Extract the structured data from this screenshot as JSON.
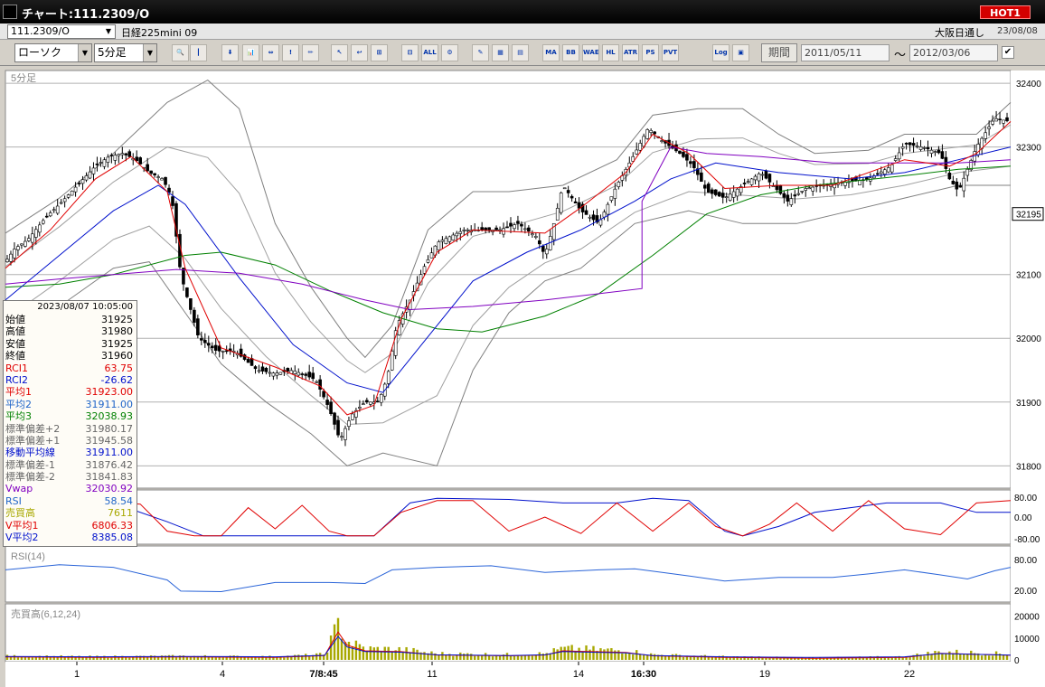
{
  "window": {
    "title": "チャート:111.2309/O",
    "hot_label": "HOT1"
  },
  "symbol_bar": {
    "symbol": "111.2309/O",
    "name": "日経225mini 09",
    "market": "大阪日通し",
    "date": "23/08/08"
  },
  "toolbar": {
    "chart_type": "ローソク",
    "interval": "5分足",
    "buttons": [
      "🔍",
      "┃",
      "⬇",
      "📊",
      "⇔",
      "!",
      "✏",
      "↖",
      "↩",
      "⊞",
      "⊟",
      "ALL",
      "⚙",
      "✎",
      "▦",
      "▤",
      "MA",
      "BB",
      "WAE",
      "HL",
      "ATR",
      "PS",
      "PVT",
      "Log",
      "▣"
    ],
    "period_label": "期間",
    "date_from": "2011/05/11",
    "date_to": "2012/03/06",
    "date_sep": "〜",
    "checked": "✔"
  },
  "colors": {
    "chart_bg": "#ffffff",
    "ma1": "#e00000",
    "ma2": "#0010cc",
    "ma3": "#008000",
    "vwap": "#8000c0",
    "bb": "#808080",
    "rsi_line": "#2a64d8",
    "volume": "#a8a800",
    "rci1": "#e00000",
    "rci2": "#0010cc"
  },
  "main_chart": {
    "label": "5分足",
    "y_axis": [
      "32400",
      "32300",
      "32195",
      "32100",
      "32000",
      "31900",
      "31800"
    ],
    "current_price": "32195",
    "ylim": [
      31765,
      32420
    ]
  },
  "rci_panel": {
    "y_axis": [
      "80.00",
      "0.00",
      "-80.00"
    ]
  },
  "rsi_panel": {
    "label": "RSI(14)",
    "y_axis": [
      "80.00",
      "20.00"
    ]
  },
  "volume_panel": {
    "label": "売買高(6,12,24)",
    "y_axis": [
      "20000",
      "10000",
      "0"
    ]
  },
  "x_axis": [
    "1",
    "4",
    "7/8:45",
    "11",
    "14",
    "16:30",
    "19",
    "22"
  ],
  "info_panel": {
    "timestamp": "2023/08/07  10:05:00",
    "rows": [
      {
        "label": "始値",
        "value": "31925",
        "color": "#000000"
      },
      {
        "label": "高値",
        "value": "31980",
        "color": "#000000"
      },
      {
        "label": "安値",
        "value": "31925",
        "color": "#000000"
      },
      {
        "label": "終値",
        "value": "31960",
        "color": "#000000"
      },
      {
        "label": "RCI1",
        "value": "63.75",
        "color": "#e00000"
      },
      {
        "label": "RCI2",
        "value": "-26.62",
        "color": "#0010cc"
      },
      {
        "label": "平均1",
        "value": "31923.00",
        "color": "#e00000"
      },
      {
        "label": "平均2",
        "value": "31911.00",
        "color": "#1e64c8"
      },
      {
        "label": "平均3",
        "value": "32038.93",
        "color": "#008000"
      },
      {
        "label": "標準偏差+2",
        "value": "31980.17",
        "color": "#666666"
      },
      {
        "label": "標準偏差+1",
        "value": "31945.58",
        "color": "#666666"
      },
      {
        "label": "移動平均線",
        "value": "31911.00",
        "color": "#0010cc"
      },
      {
        "label": "標準偏差-1",
        "value": "31876.42",
        "color": "#666666"
      },
      {
        "label": "標準偏差-2",
        "value": "31841.83",
        "color": "#666666"
      },
      {
        "label": "Vwap",
        "value": "32030.92",
        "color": "#8000c0"
      },
      {
        "label": "RSI",
        "value": "58.54",
        "color": "#1e64c8"
      },
      {
        "label": "売買高",
        "value": "7611",
        "color": "#a8a800"
      },
      {
        "label": "V平均1",
        "value": "6806.33",
        "color": "#e00000"
      },
      {
        "label": "V平均2",
        "value": "8385.08",
        "color": "#0010cc"
      }
    ]
  },
  "chart_data": {
    "type": "candlestick",
    "interval": "5分足",
    "ylim": [
      31765,
      32420
    ],
    "price_path": [
      [
        0,
        32120
      ],
      [
        10,
        32140
      ],
      [
        25,
        32155
      ],
      [
        45,
        32190
      ],
      [
        60,
        32210
      ],
      [
        80,
        32240
      ],
      [
        100,
        32270
      ],
      [
        115,
        32285
      ],
      [
        130,
        32290
      ],
      [
        145,
        32280
      ],
      [
        160,
        32260
      ],
      [
        175,
        32250
      ],
      [
        185,
        32220
      ],
      [
        195,
        32100
      ],
      [
        205,
        32050
      ],
      [
        215,
        32000
      ],
      [
        235,
        31980
      ],
      [
        255,
        31980
      ],
      [
        280,
        31950
      ],
      [
        300,
        31945
      ],
      [
        320,
        31950
      ],
      [
        345,
        31935
      ],
      [
        360,
        31890
      ],
      [
        372,
        31840
      ],
      [
        385,
        31880
      ],
      [
        400,
        31900
      ],
      [
        415,
        31900
      ],
      [
        425,
        31940
      ],
      [
        435,
        32020
      ],
      [
        450,
        32060
      ],
      [
        465,
        32110
      ],
      [
        480,
        32150
      ],
      [
        495,
        32160
      ],
      [
        510,
        32170
      ],
      [
        530,
        32170
      ],
      [
        550,
        32170
      ],
      [
        570,
        32180
      ],
      [
        590,
        32160
      ],
      [
        600,
        32130
      ],
      [
        610,
        32180
      ],
      [
        620,
        32240
      ],
      [
        640,
        32200
      ],
      [
        660,
        32180
      ],
      [
        680,
        32240
      ],
      [
        700,
        32290
      ],
      [
        715,
        32330
      ],
      [
        730,
        32310
      ],
      [
        750,
        32290
      ],
      [
        765,
        32270
      ],
      [
        780,
        32230
      ],
      [
        800,
        32220
      ],
      [
        820,
        32240
      ],
      [
        840,
        32260
      ],
      [
        860,
        32230
      ],
      [
        870,
        32215
      ],
      [
        890,
        32235
      ],
      [
        910,
        32240
      ],
      [
        935,
        32245
      ],
      [
        960,
        32250
      ],
      [
        985,
        32270
      ],
      [
        1000,
        32305
      ],
      [
        1020,
        32300
      ],
      [
        1040,
        32290
      ],
      [
        1050,
        32250
      ],
      [
        1060,
        32230
      ],
      [
        1080,
        32300
      ],
      [
        1100,
        32345
      ],
      [
        1118,
        32340
      ]
    ],
    "ma_fast_path": [
      [
        0,
        32110
      ],
      [
        50,
        32170
      ],
      [
        100,
        32250
      ],
      [
        140,
        32285
      ],
      [
        180,
        32230
      ],
      [
        200,
        32110
      ],
      [
        240,
        31985
      ],
      [
        300,
        31955
      ],
      [
        350,
        31925
      ],
      [
        380,
        31880
      ],
      [
        410,
        31895
      ],
      [
        440,
        32030
      ],
      [
        480,
        32135
      ],
      [
        520,
        32170
      ],
      [
        600,
        32165
      ],
      [
        640,
        32205
      ],
      [
        690,
        32260
      ],
      [
        720,
        32320
      ],
      [
        760,
        32290
      ],
      [
        800,
        32235
      ],
      [
        860,
        32240
      ],
      [
        920,
        32240
      ],
      [
        1000,
        32280
      ],
      [
        1050,
        32270
      ],
      [
        1080,
        32290
      ],
      [
        1118,
        32340
      ]
    ],
    "ma_mid_path": [
      [
        0,
        32060
      ],
      [
        60,
        32130
      ],
      [
        120,
        32200
      ],
      [
        170,
        32240
      ],
      [
        200,
        32210
      ],
      [
        260,
        32095
      ],
      [
        320,
        31990
      ],
      [
        380,
        31930
      ],
      [
        420,
        31915
      ],
      [
        460,
        31985
      ],
      [
        520,
        32090
      ],
      [
        580,
        32135
      ],
      [
        640,
        32170
      ],
      [
        700,
        32215
      ],
      [
        740,
        32250
      ],
      [
        790,
        32275
      ],
      [
        860,
        32260
      ],
      [
        940,
        32250
      ],
      [
        1000,
        32260
      ],
      [
        1060,
        32280
      ],
      [
        1118,
        32300
      ]
    ],
    "ma_slow_path": [
      [
        0,
        32080
      ],
      [
        60,
        32085
      ],
      [
        120,
        32100
      ],
      [
        200,
        32130
      ],
      [
        240,
        32135
      ],
      [
        300,
        32115
      ],
      [
        360,
        32075
      ],
      [
        420,
        32040
      ],
      [
        480,
        32015
      ],
      [
        530,
        32010
      ],
      [
        600,
        32035
      ],
      [
        660,
        32070
      ],
      [
        720,
        32130
      ],
      [
        780,
        32195
      ],
      [
        840,
        32225
      ],
      [
        900,
        32240
      ],
      [
        1000,
        32255
      ],
      [
        1060,
        32265
      ],
      [
        1118,
        32270
      ]
    ],
    "vwap_path": [
      [
        0,
        32085
      ],
      [
        60,
        32093
      ],
      [
        120,
        32100
      ],
      [
        190,
        32108
      ],
      [
        260,
        32102
      ],
      [
        330,
        32085
      ],
      [
        400,
        32060
      ],
      [
        450,
        32045
      ],
      [
        520,
        32050
      ],
      [
        600,
        32060
      ],
      [
        660,
        32070
      ],
      [
        708,
        32078
      ],
      [
        708,
        32215
      ],
      [
        740,
        32300
      ],
      [
        780,
        32290
      ],
      [
        840,
        32285
      ],
      [
        920,
        32275
      ],
      [
        1000,
        32275
      ],
      [
        1060,
        32275
      ],
      [
        1118,
        32280
      ]
    ],
    "bb_upper_path": [
      [
        0,
        32165
      ],
      [
        60,
        32220
      ],
      [
        120,
        32290
      ],
      [
        180,
        32370
      ],
      [
        225,
        32405
      ],
      [
        260,
        32360
      ],
      [
        300,
        32180
      ],
      [
        340,
        32080
      ],
      [
        380,
        32000
      ],
      [
        400,
        31970
      ],
      [
        430,
        32020
      ],
      [
        470,
        32170
      ],
      [
        520,
        32230
      ],
      [
        560,
        32230
      ],
      [
        620,
        32240
      ],
      [
        680,
        32280
      ],
      [
        720,
        32350
      ],
      [
        770,
        32360
      ],
      [
        820,
        32360
      ],
      [
        860,
        32320
      ],
      [
        900,
        32290
      ],
      [
        960,
        32295
      ],
      [
        1000,
        32320
      ],
      [
        1050,
        32320
      ],
      [
        1080,
        32320
      ],
      [
        1118,
        32370
      ]
    ],
    "bb_lower_path": [
      [
        0,
        32000
      ],
      [
        60,
        32050
      ],
      [
        120,
        32110
      ],
      [
        160,
        32120
      ],
      [
        200,
        32040
      ],
      [
        240,
        31960
      ],
      [
        290,
        31900
      ],
      [
        340,
        31850
      ],
      [
        380,
        31800
      ],
      [
        420,
        31820
      ],
      [
        450,
        31810
      ],
      [
        480,
        31800
      ],
      [
        520,
        31950
      ],
      [
        560,
        32040
      ],
      [
        600,
        32090
      ],
      [
        640,
        32110
      ],
      [
        700,
        32180
      ],
      [
        760,
        32200
      ],
      [
        820,
        32180
      ],
      [
        880,
        32180
      ],
      [
        940,
        32200
      ],
      [
        1000,
        32220
      ],
      [
        1060,
        32240
      ],
      [
        1118,
        32240
      ]
    ],
    "rci1_path": [
      [
        0,
        70
      ],
      [
        30,
        70
      ],
      [
        60,
        -60
      ],
      [
        90,
        -20
      ],
      [
        120,
        65
      ],
      [
        150,
        55
      ],
      [
        180,
        -60
      ],
      [
        210,
        -80
      ],
      [
        240,
        -80
      ],
      [
        270,
        40
      ],
      [
        300,
        -50
      ],
      [
        330,
        50
      ],
      [
        360,
        -60
      ],
      [
        380,
        -80
      ],
      [
        410,
        -80
      ],
      [
        440,
        20
      ],
      [
        480,
        70
      ],
      [
        520,
        70
      ],
      [
        560,
        -60
      ],
      [
        600,
        0
      ],
      [
        640,
        -70
      ],
      [
        680,
        60
      ],
      [
        720,
        -60
      ],
      [
        760,
        60
      ],
      [
        790,
        -40
      ],
      [
        820,
        -80
      ],
      [
        850,
        -30
      ],
      [
        880,
        60
      ],
      [
        920,
        -60
      ],
      [
        960,
        70
      ],
      [
        1000,
        -50
      ],
      [
        1040,
        -75
      ],
      [
        1080,
        60
      ],
      [
        1118,
        70
      ]
    ],
    "rci2_path": [
      [
        0,
        60
      ],
      [
        60,
        60
      ],
      [
        120,
        60
      ],
      [
        180,
        -20
      ],
      [
        220,
        -80
      ],
      [
        300,
        -80
      ],
      [
        360,
        -80
      ],
      [
        410,
        -80
      ],
      [
        450,
        60
      ],
      [
        480,
        80
      ],
      [
        560,
        75
      ],
      [
        620,
        60
      ],
      [
        680,
        60
      ],
      [
        720,
        80
      ],
      [
        760,
        70
      ],
      [
        800,
        -60
      ],
      [
        820,
        -80
      ],
      [
        860,
        -40
      ],
      [
        900,
        20
      ],
      [
        940,
        40
      ],
      [
        980,
        60
      ],
      [
        1040,
        60
      ],
      [
        1080,
        20
      ],
      [
        1118,
        20
      ]
    ],
    "rsi_path": [
      [
        0,
        60
      ],
      [
        60,
        70
      ],
      [
        120,
        65
      ],
      [
        180,
        40
      ],
      [
        195,
        18
      ],
      [
        240,
        17
      ],
      [
        300,
        35
      ],
      [
        360,
        35
      ],
      [
        400,
        33
      ],
      [
        430,
        60
      ],
      [
        480,
        65
      ],
      [
        540,
        68
      ],
      [
        600,
        55
      ],
      [
        660,
        60
      ],
      [
        700,
        62
      ],
      [
        760,
        48
      ],
      [
        800,
        38
      ],
      [
        860,
        45
      ],
      [
        920,
        45
      ],
      [
        960,
        52
      ],
      [
        1000,
        60
      ],
      [
        1040,
        50
      ],
      [
        1070,
        42
      ],
      [
        1100,
        58
      ],
      [
        1118,
        65
      ]
    ],
    "volume_path": [
      [
        0,
        1800
      ],
      [
        100,
        1500
      ],
      [
        200,
        1800
      ],
      [
        300,
        1500
      ],
      [
        355,
        2600
      ],
      [
        370,
        17000
      ],
      [
        380,
        9000
      ],
      [
        400,
        5500
      ],
      [
        440,
        5000
      ],
      [
        480,
        3000
      ],
      [
        560,
        2500
      ],
      [
        600,
        3000
      ],
      [
        620,
        5500
      ],
      [
        690,
        4500
      ],
      [
        720,
        2500
      ],
      [
        800,
        1500
      ],
      [
        900,
        1000
      ],
      [
        1000,
        1500
      ],
      [
        1040,
        4000
      ],
      [
        1118,
        2800
      ]
    ]
  }
}
